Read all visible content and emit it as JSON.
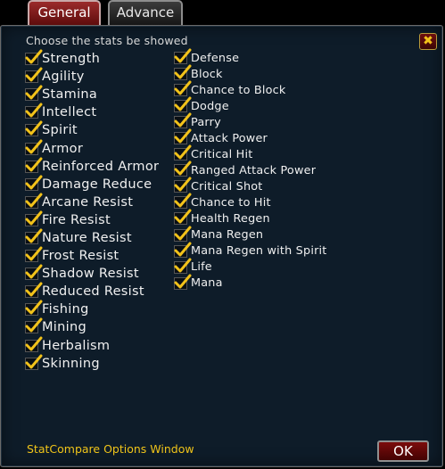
{
  "tabs": {
    "general": "General",
    "advance": "Advance"
  },
  "close_icon_glyph": "✖",
  "header_text": "Choose the stats be showed",
  "column1": [
    {
      "label": "Strength",
      "checked": true
    },
    {
      "label": "Agility",
      "checked": true
    },
    {
      "label": "Stamina",
      "checked": true
    },
    {
      "label": "Intellect",
      "checked": true
    },
    {
      "label": "Spirit",
      "checked": true
    },
    {
      "label": "Armor",
      "checked": true
    },
    {
      "label": "Reinforced Armor",
      "checked": true
    },
    {
      "label": "Damage Reduce",
      "checked": true
    },
    {
      "label": "Arcane Resist",
      "checked": true
    },
    {
      "label": "Fire Resist",
      "checked": true
    },
    {
      "label": "Nature Resist",
      "checked": true
    },
    {
      "label": "Frost Resist",
      "checked": true
    },
    {
      "label": "Shadow Resist",
      "checked": true
    },
    {
      "label": "Reduced Resist",
      "checked": true
    },
    {
      "label": "Fishing",
      "checked": true
    },
    {
      "label": "Mining",
      "checked": true
    },
    {
      "label": "Herbalism",
      "checked": true
    },
    {
      "label": "Skinning",
      "checked": true
    }
  ],
  "column2": [
    {
      "label": "Defense",
      "checked": true
    },
    {
      "label": "Block",
      "checked": true
    },
    {
      "label": "Chance to Block",
      "checked": true
    },
    {
      "label": "Dodge",
      "checked": true
    },
    {
      "label": "Parry",
      "checked": true
    },
    {
      "label": "Attack Power",
      "checked": true
    },
    {
      "label": "Critical Hit",
      "checked": true
    },
    {
      "label": "Ranged Attack Power",
      "checked": true
    },
    {
      "label": "Critical Shot",
      "checked": true
    },
    {
      "label": "Chance to Hit",
      "checked": true
    },
    {
      "label": "Health Regen",
      "checked": true
    },
    {
      "label": "Mana Regen",
      "checked": true
    },
    {
      "label": "Mana Regen with Spirit",
      "checked": true
    },
    {
      "label": "Life",
      "checked": true
    },
    {
      "label": "Mana",
      "checked": true
    }
  ],
  "footer_title": "StatCompare Options Window",
  "ok_label": "OK",
  "colors": {
    "check": "#f2c21a",
    "footer": "#f0c419",
    "panel": "#0e1c29"
  }
}
